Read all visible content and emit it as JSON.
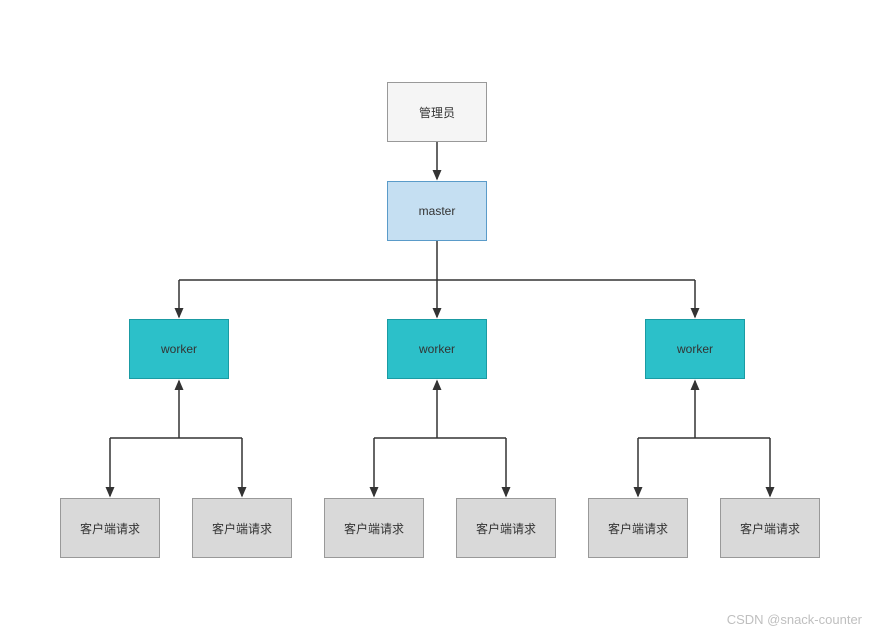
{
  "diagram": {
    "admin": {
      "label": "管理员"
    },
    "master": {
      "label": "master"
    },
    "workers": [
      {
        "label": "worker"
      },
      {
        "label": "worker"
      },
      {
        "label": "worker"
      }
    ],
    "clients": [
      {
        "label": "客户端请求"
      },
      {
        "label": "客户端请求"
      },
      {
        "label": "客户端请求"
      },
      {
        "label": "客户端请求"
      },
      {
        "label": "客户端请求"
      },
      {
        "label": "客户端请求"
      }
    ]
  },
  "colors": {
    "admin_bg": "#f5f5f5",
    "master_bg": "#c5dff2",
    "worker_bg": "#2cc0c9",
    "client_bg": "#d9d9d9",
    "line": "#333333"
  },
  "watermark": "CSDN @snack-counter"
}
